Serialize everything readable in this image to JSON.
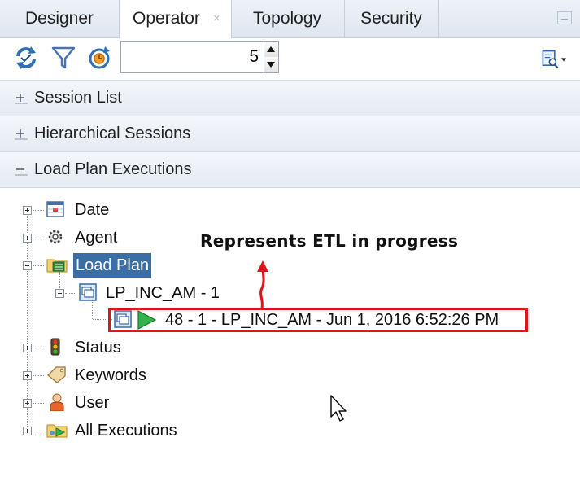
{
  "tabs": [
    {
      "label": "Designer",
      "active": false
    },
    {
      "label": "Operator",
      "active": true,
      "close_icon": "×"
    },
    {
      "label": "Topology",
      "active": false
    },
    {
      "label": "Security",
      "active": false
    }
  ],
  "toolbar": {
    "refresh_icon": "refresh-icon",
    "filter_icon": "filter-icon",
    "auto_refresh_icon": "auto-refresh-icon",
    "count_value": "5",
    "search_icon": "search-menu-icon"
  },
  "accordion": {
    "session_list": "Session List",
    "hierarchical_sessions": "Hierarchical Sessions",
    "load_plan_executions": "Load Plan Executions"
  },
  "tree": {
    "date": "Date",
    "agent": "Agent",
    "load_plan": "Load Plan",
    "lp_inc_am": "LP_INC_AM - 1",
    "execution": "48 - 1 - LP_INC_AM - Jun 1, 2016 6:52:26 PM",
    "status": "Status",
    "keywords": "Keywords",
    "user": "User",
    "all_executions": "All Executions"
  },
  "annotation": {
    "text": "Represents ETL in progress",
    "color": "#e2131b"
  }
}
